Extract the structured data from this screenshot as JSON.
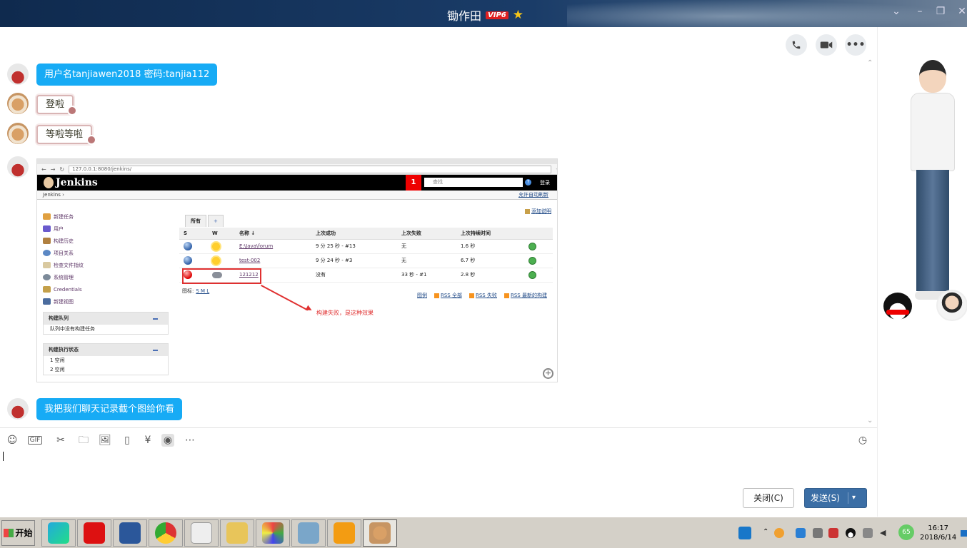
{
  "window": {
    "title": "锄作田",
    "vip_badge": "VIP6"
  },
  "messages": {
    "m1": "用户名tanjiawen2018 密码:tanjia112",
    "m2": "登啦",
    "m3": "等啦等啦",
    "m5": "我把我们聊天记录截个图给你看"
  },
  "screenshot": {
    "url": "127.0.0.1:8080/jenkins/",
    "brand": "Jenkins",
    "build_count": "1",
    "search_placeholder": "查找",
    "help": "?",
    "login": "登录",
    "breadcrumb": "Jenkins",
    "auto_refresh": "允许自动刷新",
    "add_desc": "添加说明",
    "sidebar": [
      "新建任务",
      "用户",
      "构建历史",
      "项目关系",
      "检查文件指纹",
      "系统管理",
      "Credentials",
      "新建视图"
    ],
    "queue_title": "构建队列",
    "queue_empty": "队列中没有构建任务",
    "executor_title": "构建执行状态",
    "executors": [
      "1  空闲",
      "2  空闲"
    ],
    "tab_all": "所有",
    "tab_add": "+",
    "columns": [
      "S",
      "W",
      "名称 ↓",
      "上次成功",
      "上次失败",
      "上次持续时间"
    ],
    "jobs": [
      {
        "name": "E:\\Java\\forum",
        "success": "9 分 25 秒 - #13",
        "failure": "无",
        "duration": "1.6 秒",
        "status": "blue",
        "weather": "sunny"
      },
      {
        "name": "test-002",
        "success": "9 分 24 秒 - #3",
        "failure": "无",
        "duration": "6.7 秒",
        "status": "blue",
        "weather": "sunny"
      },
      {
        "name": "121212",
        "success": "没有",
        "failure": "33 秒 - #1",
        "duration": "2.8 秒",
        "status": "red",
        "weather": "cloudy"
      }
    ],
    "legend_label": "图标:",
    "legend_sizes": "S M L",
    "legend_link": "图例",
    "rss": [
      "RSS 全部",
      "RSS 失败",
      "RSS 最新的构建"
    ],
    "annotation": "构建失败，是这种效果"
  },
  "buttons": {
    "close": "关闭(C)",
    "send": "发送(S)"
  },
  "taskbar": {
    "start": "开始",
    "time": "16:17",
    "date": "2018/6/14",
    "badge": "65"
  },
  "colors": {
    "bubble": "#17abf5",
    "send": "#3b6ea5",
    "title_bar": "#1a3c68"
  },
  "icons": [
    "phone-icon",
    "video-icon",
    "more-icon",
    "emoji-icon",
    "gif-icon",
    "scissors-icon",
    "folder-icon",
    "image-icon",
    "vibrate-icon",
    "red-packet-icon",
    "music-icon",
    "more-tools-icon",
    "history-icon"
  ]
}
